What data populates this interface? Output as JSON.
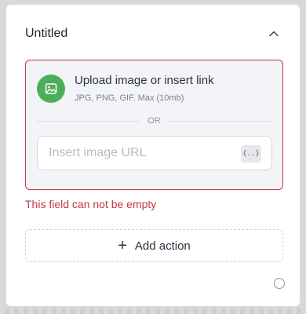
{
  "card": {
    "title": "Untitled"
  },
  "upload": {
    "title": "Upload image or insert link",
    "subtitle": "JPG, PNG, GIF. Max (10mb)",
    "or_label": "OR",
    "url_placeholder": "Insert image URL",
    "url_value": "",
    "variable_button_label": "{..}",
    "icon": "image-icon"
  },
  "validation": {
    "error_message": "This field can not be empty"
  },
  "actions": {
    "add_action_label": "Add action"
  },
  "colors": {
    "error": "#c8344a",
    "accent_green": "#4cae58"
  }
}
